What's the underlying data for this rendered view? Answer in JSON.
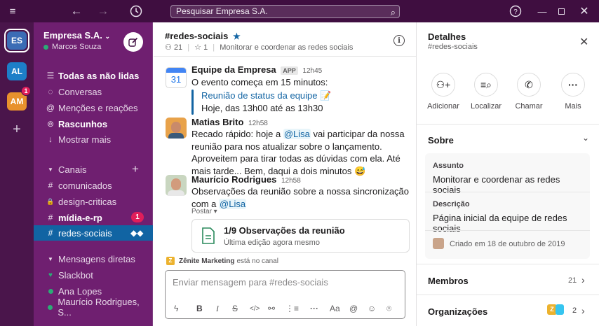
{
  "titlebar": {
    "menu_icon": "hamburger-icon",
    "search_placeholder": "Pesquisar Empresa S.A."
  },
  "workspaces": [
    {
      "initials": "ES",
      "active": true,
      "color": "#3b6cb5"
    },
    {
      "initials": "AL",
      "active": false,
      "color": "#1d7fc8"
    },
    {
      "initials": "AM",
      "active": false,
      "color": "#e8912d",
      "badge": "1"
    }
  ],
  "sidebar": {
    "workspace_name": "Empresa S.A.",
    "user_name": "Marcos Souza",
    "nav": [
      {
        "label": "Todas as não lidas",
        "icon": "threads-icon",
        "bold": true
      },
      {
        "label": "Conversas",
        "icon": "conversations-icon",
        "bold": false
      },
      {
        "label": "Menções e reações",
        "icon": "at-icon",
        "bold": false
      },
      {
        "label": "Rascunhos",
        "icon": "drafts-icon",
        "bold": true
      },
      {
        "label": "Mostrar mais",
        "icon": "more-arrow-icon",
        "bold": false
      }
    ],
    "channels_header": "Canais",
    "channels": [
      {
        "name": "comunicados",
        "prefix": "#",
        "bold": false
      },
      {
        "name": "design-criticas",
        "prefix": "🔒",
        "bold": false
      },
      {
        "name": "mídia-e-rp",
        "prefix": "#",
        "bold": true,
        "badge": "1"
      },
      {
        "name": "redes-sociais",
        "prefix": "#",
        "bold": false,
        "selected": true
      }
    ],
    "dm_header": "Mensagens diretas",
    "dms": [
      {
        "name": "Slackbot",
        "icon": "heart-icon"
      },
      {
        "name": "Ana Lopes",
        "icon": "presence-icon"
      },
      {
        "name": "Maurício Rodrigues, S...",
        "icon": "presence-icon"
      }
    ]
  },
  "channel": {
    "name": "#redes-sociais",
    "member_count": "21",
    "pins": "1",
    "topic": "Monitorar e coordenar as redes sociais"
  },
  "messages": [
    {
      "author": "Equipe da Empresa",
      "app_badge": "APP",
      "time": "12h45",
      "calendar_day": "31",
      "text": "O evento começa em 15 minutos:",
      "event_title": "Reunião de status da equipe",
      "event_time": "Hoje, das 13h00 até as 13h30"
    },
    {
      "author": "Matias Brito",
      "time": "12h58",
      "text_before": "Recado rápido: hoje a",
      "mention": "@Lisa",
      "text_after": "vai participar da nossa reunião para nos atualizar sobre o lançamento. Aproveitem para tirar todas as dúvidas com ela. Até mais tarde... Bem, daqui a dois minutos 😅"
    },
    {
      "author": "Maurício Rodrigues",
      "time": "12h58",
      "text_before": "Observações da reunião sobre a nossa sincronização com a",
      "mention": "@Lisa",
      "post_label": "Postar ▾",
      "file_title": "1/9 Observações da reunião",
      "file_subtitle": "Última edição agora mesmo"
    }
  ],
  "typing": {
    "badge": "Z",
    "name": "Zênite Marketing",
    "suffix": "está no canal"
  },
  "composer": {
    "placeholder": "Enviar mensagem para #redes-sociais",
    "tools": [
      "lightning-icon",
      "bold-icon",
      "italic-icon",
      "strike-icon",
      "code-icon",
      "link-icon",
      "list-icon",
      "more-icon",
      "text-format-icon",
      "mention-icon",
      "emoji-icon",
      "attach-icon"
    ]
  },
  "details": {
    "title": "Detalhes",
    "subtitle": "#redes-sociais",
    "actions": [
      {
        "label": "Adicionar",
        "icon": "add-person-icon"
      },
      {
        "label": "Localizar",
        "icon": "find-icon"
      },
      {
        "label": "Chamar",
        "icon": "phone-icon"
      },
      {
        "label": "Mais",
        "icon": "more-icon"
      }
    ],
    "about_header": "Sobre",
    "topic_label": "Assunto",
    "topic_value": "Monitorar e coordenar as redes sociais",
    "description_label": "Descrição",
    "description_value": "Página inicial da equipe de redes sociais",
    "created": "Criado em 18 de outubro de 2019",
    "members_label": "Membros",
    "members_count": "21",
    "orgs_label": "Organizações",
    "orgs_count": "2"
  }
}
